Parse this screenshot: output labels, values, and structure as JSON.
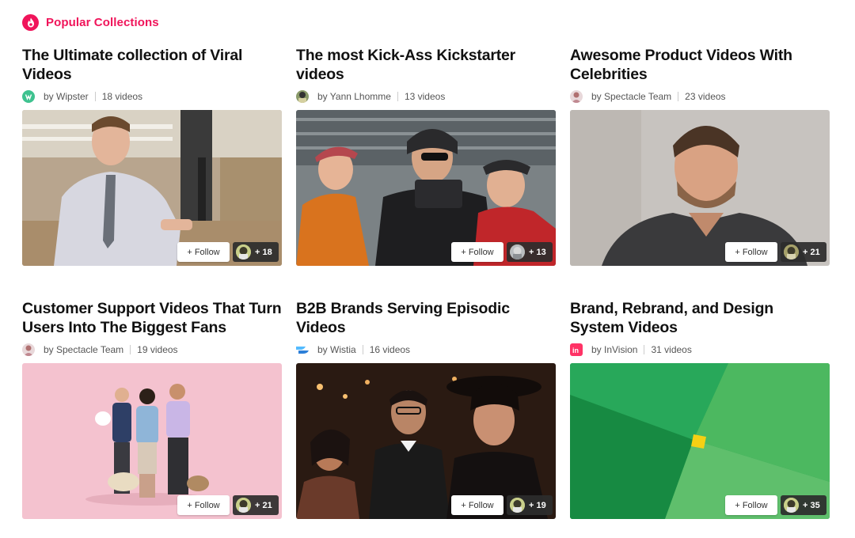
{
  "section": {
    "title": "Popular Collections",
    "icon": "fire-icon",
    "accent": "#f0145a"
  },
  "collections": [
    {
      "title": "The Ultimate collection of Viral Videos",
      "author": "by Wipster",
      "count": "18 videos",
      "follow_label": "+ Follow",
      "followers": "+ 18",
      "author_icon": "wipster-logo-icon"
    },
    {
      "title": "The most Kick-Ass Kickstarter videos",
      "author": "by Yann Lhomme",
      "count": "13 videos",
      "follow_label": "+ Follow",
      "followers": "+ 13",
      "author_icon": "user-avatar"
    },
    {
      "title": "Awesome Product Videos With Celebrities",
      "author": "by Spectacle Team",
      "count": "23 videos",
      "follow_label": "+ Follow",
      "followers": "+ 21",
      "author_icon": "user-avatar"
    },
    {
      "title": "Customer Support Videos That Turn Users Into The Biggest Fans",
      "author": "by Spectacle Team",
      "count": "19 videos",
      "follow_label": "+ Follow",
      "followers": "+ 21",
      "author_icon": "user-avatar"
    },
    {
      "title": "B2B Brands Serving Episodic Videos",
      "author": "by Wistia",
      "count": "16 videos",
      "follow_label": "+ Follow",
      "followers": "+ 19",
      "author_icon": "wistia-logo-icon"
    },
    {
      "title": "Brand, Rebrand, and Design System Videos",
      "author": "by InVision",
      "count": "31 videos",
      "follow_label": "+ Follow",
      "followers": "+ 35",
      "author_icon": "invision-logo-icon"
    }
  ]
}
